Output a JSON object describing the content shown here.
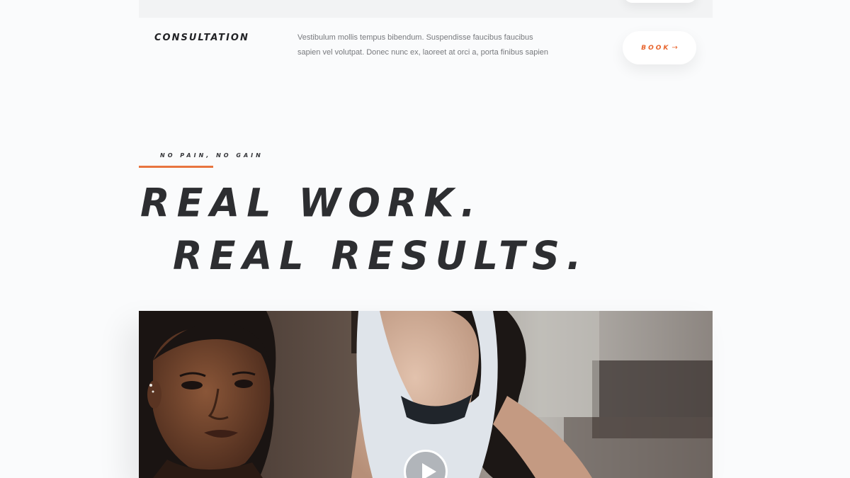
{
  "service_row": {
    "name": "CONSULTATION",
    "description_line1": "Vestibulum mollis tempus bibendum. Suspendisse faucibus faucibus",
    "description_line2": "sapien vel volutpat. Donec nunc ex, laoreet at orci a, porta finibus sapien",
    "button_label": "BOOK",
    "button_icon": "arrow-right-icon"
  },
  "hero": {
    "eyebrow": "NO PAIN, NO GAIN",
    "headline_line1": "REAL WORK.",
    "headline_line2": "REAL RESULTS."
  },
  "media": {
    "play_icon": "play-icon"
  },
  "colors": {
    "accent": "#e8642c",
    "heading": "#2d2e31",
    "body_text": "#77797d",
    "background": "#fafbfc"
  }
}
